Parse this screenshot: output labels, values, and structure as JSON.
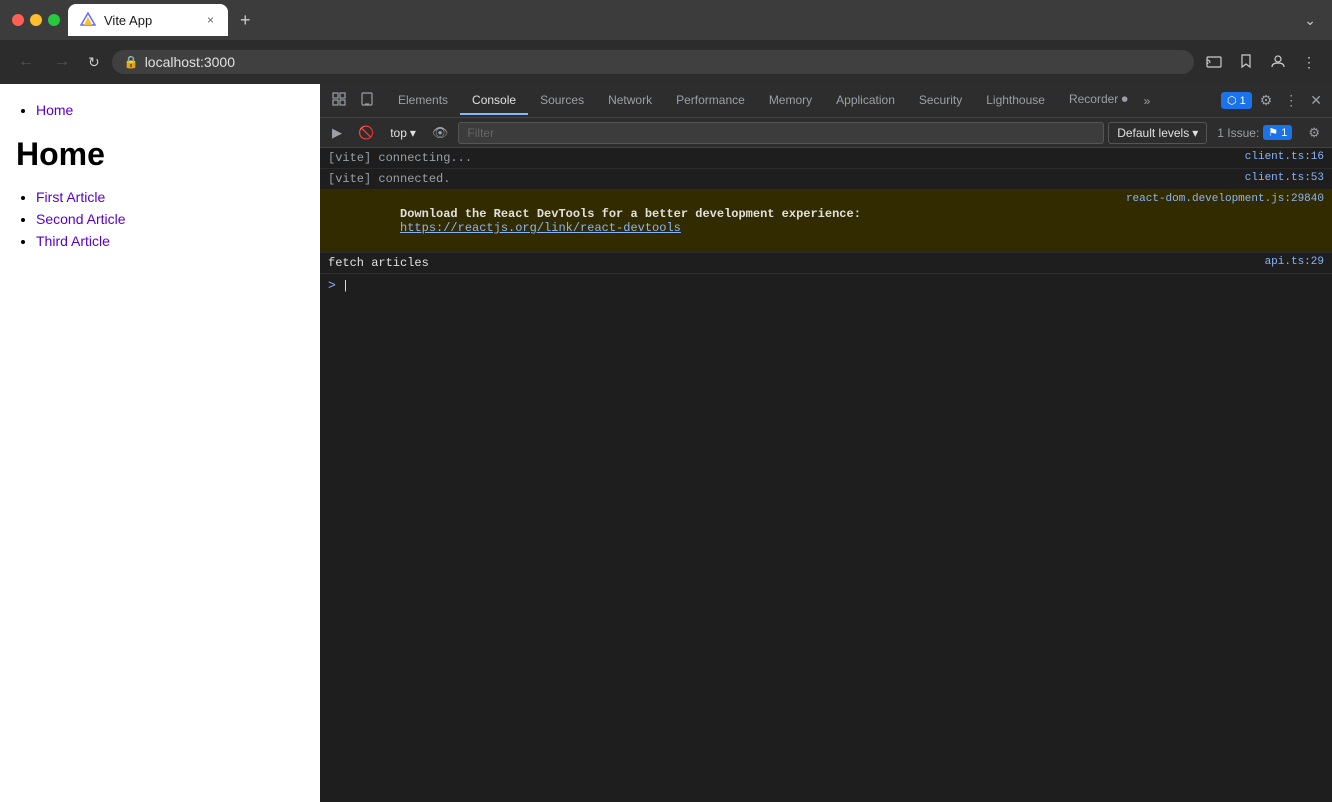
{
  "browser": {
    "title_bar": {
      "tab_title": "Vite App",
      "tab_close_label": "×",
      "new_tab_label": "+",
      "tab_chevron": "⌄"
    },
    "nav_bar": {
      "back_label": "←",
      "forward_label": "→",
      "reload_label": "↻",
      "url": "localhost:3000",
      "lock_icon": "🔒",
      "cast_icon": "⬡",
      "bookmark_icon": "☆",
      "extension_icon": "⬡",
      "split_icon": "⬡",
      "profile_icon": "⬡",
      "more_icon": "⋮"
    }
  },
  "webpage": {
    "nav_links": [
      "Home"
    ],
    "heading": "Home",
    "articles": [
      {
        "label": "First Article",
        "href": "#"
      },
      {
        "label": "Second Article",
        "href": "#"
      },
      {
        "label": "Third Article",
        "href": "#"
      }
    ]
  },
  "devtools": {
    "tabs": [
      "Elements",
      "Console",
      "Sources",
      "Network",
      "Performance",
      "Memory",
      "Application",
      "Security",
      "Lighthouse",
      "Recorder ⏺"
    ],
    "active_tab": "Console",
    "more_tabs_label": "»",
    "top_right": {
      "frames_label": "⬡ 1",
      "settings_label": "⚙",
      "more_label": "⋮",
      "close_label": "✕",
      "issues_label": "1 Issue:",
      "issues_badge": "⚑ 1"
    },
    "toolbar": {
      "run_btn": "▶",
      "clear_btn": "🚫",
      "context_label": "top",
      "context_arrow": "▾",
      "eye_btn": "👁",
      "filter_placeholder": "Filter",
      "levels_label": "Default levels",
      "levels_arrow": "▾",
      "issue_label": "1 Issue:",
      "issue_badge": "⚑ 1",
      "settings_btn": "⚙"
    },
    "console_lines": [
      {
        "type": "normal",
        "message": "[vite] connecting...",
        "source": "client.ts:16"
      },
      {
        "type": "normal",
        "message": "[vite] connected.",
        "source": "client.ts:53"
      },
      {
        "type": "warn",
        "message_prefix": "Download the React DevTools for a better development experience: ",
        "message_link": "https://reactjs.org/link/react-devtools",
        "source": "react-dom.development.js:29840"
      },
      {
        "type": "normal",
        "message": "fetch articles",
        "source": "api.ts:29"
      }
    ]
  }
}
